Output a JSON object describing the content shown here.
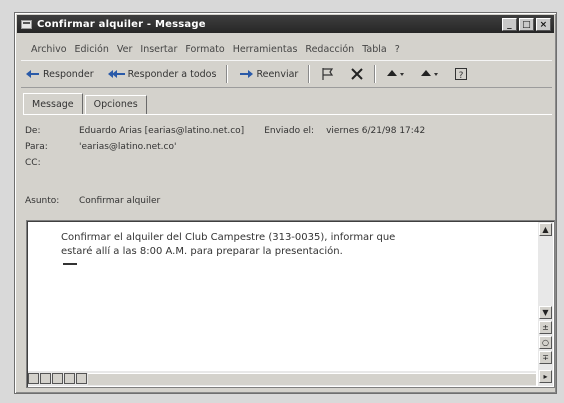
{
  "window": {
    "title": "Confirmar alquiler - Message",
    "controls": [
      "_",
      "□",
      "×"
    ]
  },
  "menu": [
    "Archivo",
    "Edición",
    "Ver",
    "Insertar",
    "Formato",
    "Herramientas",
    "Redacción",
    "Tabla",
    "?"
  ],
  "toolbar": {
    "reply": "Responder",
    "reply_all": "Responder a todos",
    "forward": "Reenviar"
  },
  "tabs": [
    "Message",
    "Opciones"
  ],
  "headers": {
    "from_label": "De:",
    "from_value": "Eduardo Arias [earias@latino.net.co]",
    "sent_label": "Enviado el:",
    "sent_value": "viernes 6/21/98 17:42",
    "to_label": "Para:",
    "to_value": "'earias@latino.net.co'",
    "cc_label": "CC:",
    "cc_value": "",
    "subject_label": "Asunto:",
    "subject_value": "Confirmar alquiler"
  },
  "message": {
    "line1": "Confirmar el alquiler del Club Campestre (313-0035), informar que",
    "line2": "estaré allí a las 8:00 A.M. para preparar la presentación."
  }
}
